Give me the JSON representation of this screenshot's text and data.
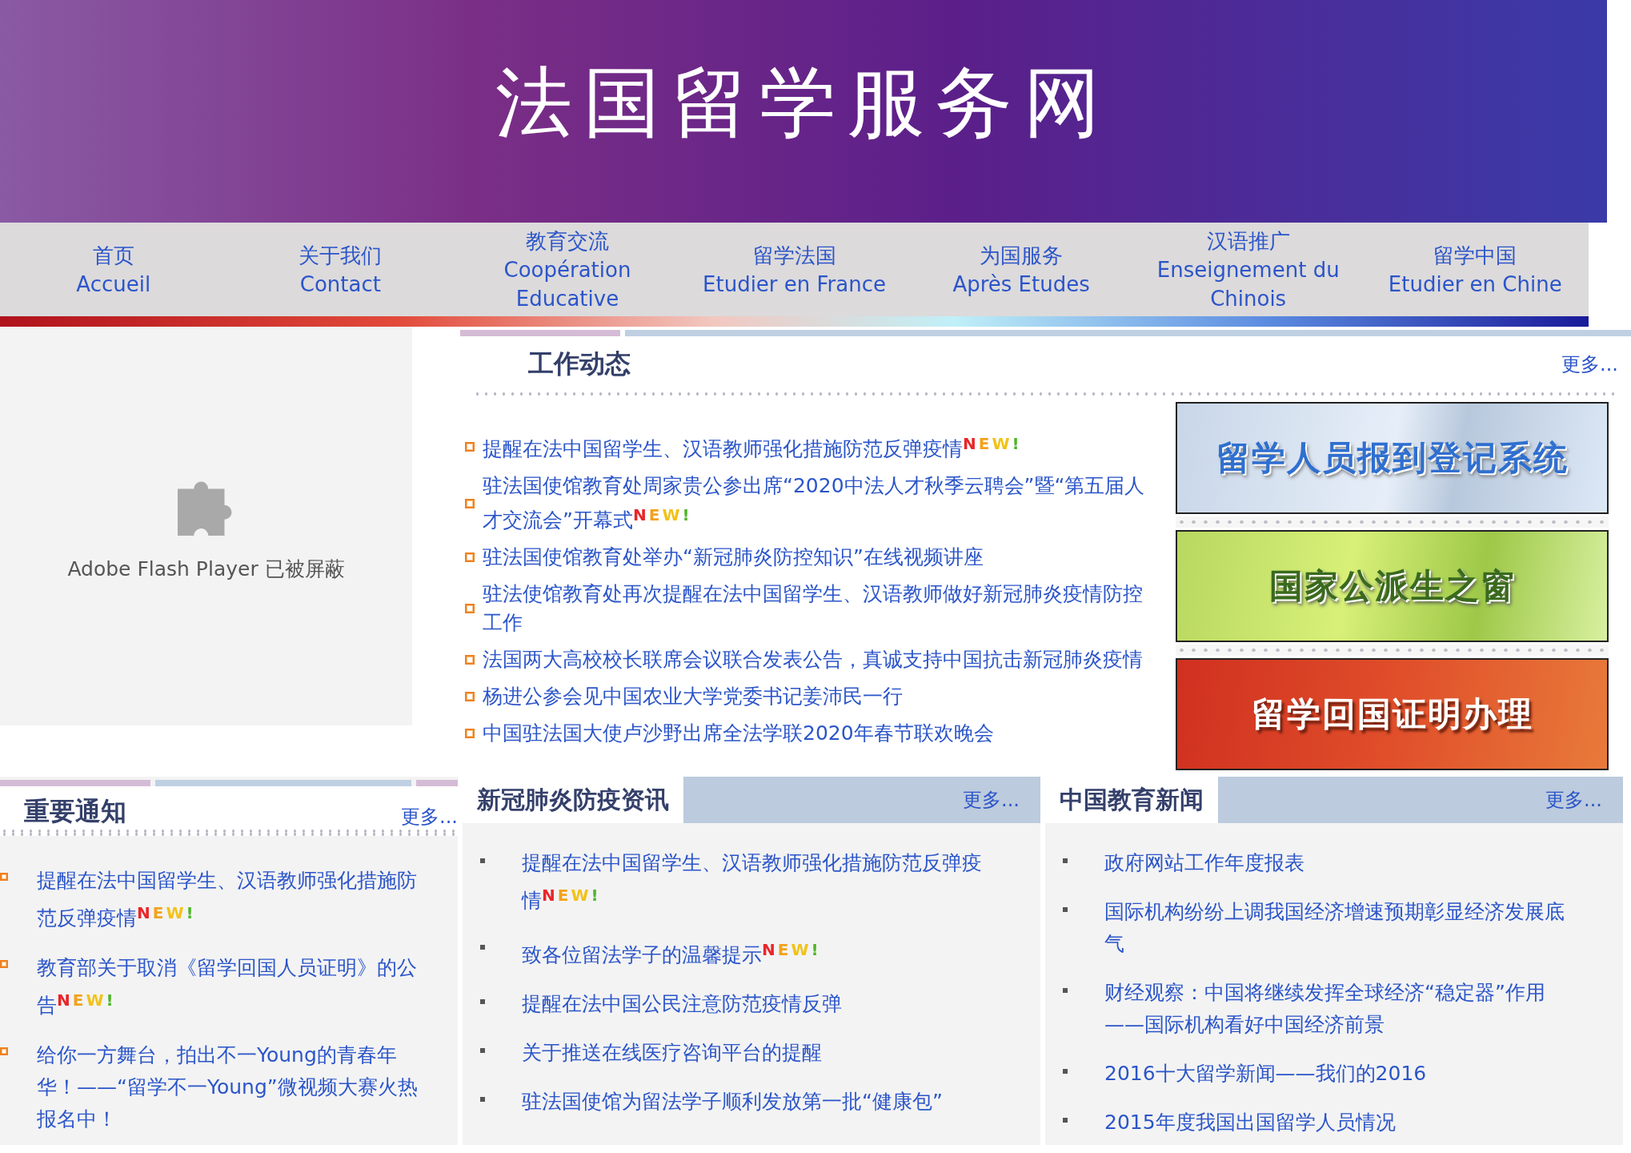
{
  "header": {
    "title": "法国留学服务网"
  },
  "nav": [
    {
      "zh": "首页",
      "fr": "Accueil"
    },
    {
      "zh": "关于我们",
      "fr": "Contact"
    },
    {
      "zh": "教育交流",
      "fr": "Coopération Educative"
    },
    {
      "zh": "留学法国",
      "fr": "Etudier en France"
    },
    {
      "zh": "为国服务",
      "fr": "Après Etudes"
    },
    {
      "zh": "汉语推广",
      "fr": "Enseignement du Chinois"
    },
    {
      "zh": "留学中国",
      "fr": "Etudier en Chine"
    }
  ],
  "flash": {
    "message": "Adobe Flash Player 已被屏蔽"
  },
  "work": {
    "title": "工作动态",
    "more": "更多...",
    "items": [
      {
        "text": "提醒在法中国留学生、汉语教师强化措施防范反弹疫情",
        "badge": "NEW!"
      },
      {
        "text": "驻法国使馆教育处周家贵公参出席“2020中法人才秋季云聘会”暨“第五届人才交流会”开幕式",
        "badge": "NEW!"
      },
      {
        "text": "驻法国使馆教育处举办“新冠肺炎防控知识”在线视频讲座"
      },
      {
        "text": "驻法使馆教育处再次提醒在法中国留学生、汉语教师做好新冠肺炎疫情防控工作"
      },
      {
        "text": "法国两大高校校长联席会议联合发表公告，真诚支持中国抗击新冠肺炎疫情"
      },
      {
        "text": "杨进公参会见中国农业大学党委书记姜沛民一行"
      },
      {
        "text": "中国驻法国大使卢沙野出席全法学联2020年春节联欢晚会"
      }
    ]
  },
  "banners": [
    {
      "text": "留学人员报到登记系统",
      "kind": "blue"
    },
    {
      "text": "国家公派生之窗",
      "kind": "green"
    },
    {
      "text": "留学回国证明办理",
      "kind": "red"
    }
  ],
  "notices": {
    "title": "重要通知",
    "more": "更多...",
    "items": [
      {
        "text": "提醒在法中国留学生、汉语教师强化措施防范反弹疫情",
        "badge": "NEW!"
      },
      {
        "text": "教育部关于取消《留学回国人员证明》的公告",
        "badge": "NEW!"
      },
      {
        "text": "给你一方舞台，拍出不一Young的青春年华！——“留学不一Young”微视频大赛火热报名中！"
      }
    ]
  },
  "covid": {
    "title": "新冠肺炎防疫资讯",
    "more": "更多...",
    "items": [
      {
        "text": "提醒在法中国留学生、汉语教师强化措施防范反弹疫情",
        "badge": "NEW!"
      },
      {
        "text": "致各位留法学子的温馨提示",
        "badge": "NEW!"
      },
      {
        "text": "提醒在法中国公民注意防范疫情反弹"
      },
      {
        "text": "关于推送在线医疗咨询平台的提醒"
      },
      {
        "text": "驻法国使馆为留法学子顺利发放第一批“健康包”"
      }
    ]
  },
  "edu": {
    "title": "中国教育新闻",
    "more": "更多...",
    "items": [
      {
        "text": "政府网站工作年度报表"
      },
      {
        "text": "国际机构纷纷上调我国经济增速预期彰显经济发展底气"
      },
      {
        "text": "财经观察：中国将继续发挥全球经济“稳定器”作用——国际机构看好中国经济前景"
      },
      {
        "text": "2016十大留学新闻——我们的2016"
      },
      {
        "text": "2015年度我国出国留学人员情况"
      }
    ]
  }
}
